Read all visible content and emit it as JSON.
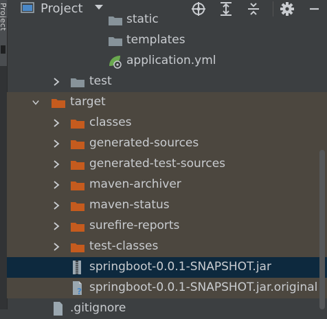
{
  "side_panel": {
    "tab_label": "Project"
  },
  "header": {
    "title": "Project"
  },
  "tree": {
    "static_label": "static",
    "templates_label": "templates",
    "application_yml_label": "application.yml",
    "test_label": "test",
    "target_label": "target",
    "target_children": [
      "classes",
      "generated-sources",
      "generated-test-sources",
      "maven-archiver",
      "maven-status",
      "surefire-reports",
      "test-classes"
    ],
    "jar_label": "springboot-0.0.1-SNAPSHOT.jar",
    "jar_original_label": "springboot-0.0.1-SNAPSHOT.jar.original",
    "gitignore_label": ".gitignore"
  },
  "colors": {
    "folder_gray": "#87939a",
    "folder_orange": "#c55b1e",
    "excluded_background": "#4c473f",
    "selection_background": "#0d293e"
  },
  "icons": {
    "project_view": "window-icon",
    "locate": "crosshair-icon",
    "expand_all": "expand-all-icon",
    "collapse_all": "collapse-all-icon",
    "settings": "gear-icon"
  }
}
